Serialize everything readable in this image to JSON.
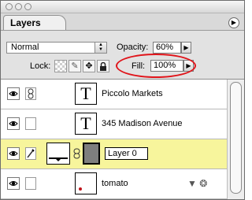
{
  "panel": {
    "tab_label": "Layers",
    "menu_arrow": "▶"
  },
  "controls": {
    "blend_mode": "Normal",
    "opacity_label": "Opacity:",
    "opacity_value": "60%",
    "lock_label": "Lock:",
    "fill_label": "Fill:",
    "fill_value": "100%",
    "arrow_glyph": "▶",
    "select_arrows": "▲▼"
  },
  "lock_icons": [
    "checker-icon",
    "brush-icon",
    "move-icon",
    "lock-icon"
  ],
  "layers": [
    {
      "name": "Piccolo Markets",
      "thumb": "T",
      "type": "text",
      "selected": false
    },
    {
      "name": "345 Madison Avenue",
      "thumb": "T",
      "type": "text",
      "selected": false
    },
    {
      "name": "Layer 0",
      "type": "image-with-mask",
      "selected": true
    },
    {
      "name": "tomato",
      "type": "image",
      "selected": false,
      "fx_icons": "▼ ❂"
    }
  ],
  "colors": {
    "selected_row": "#f7f59c",
    "highlight_circle": "#e0141a"
  }
}
